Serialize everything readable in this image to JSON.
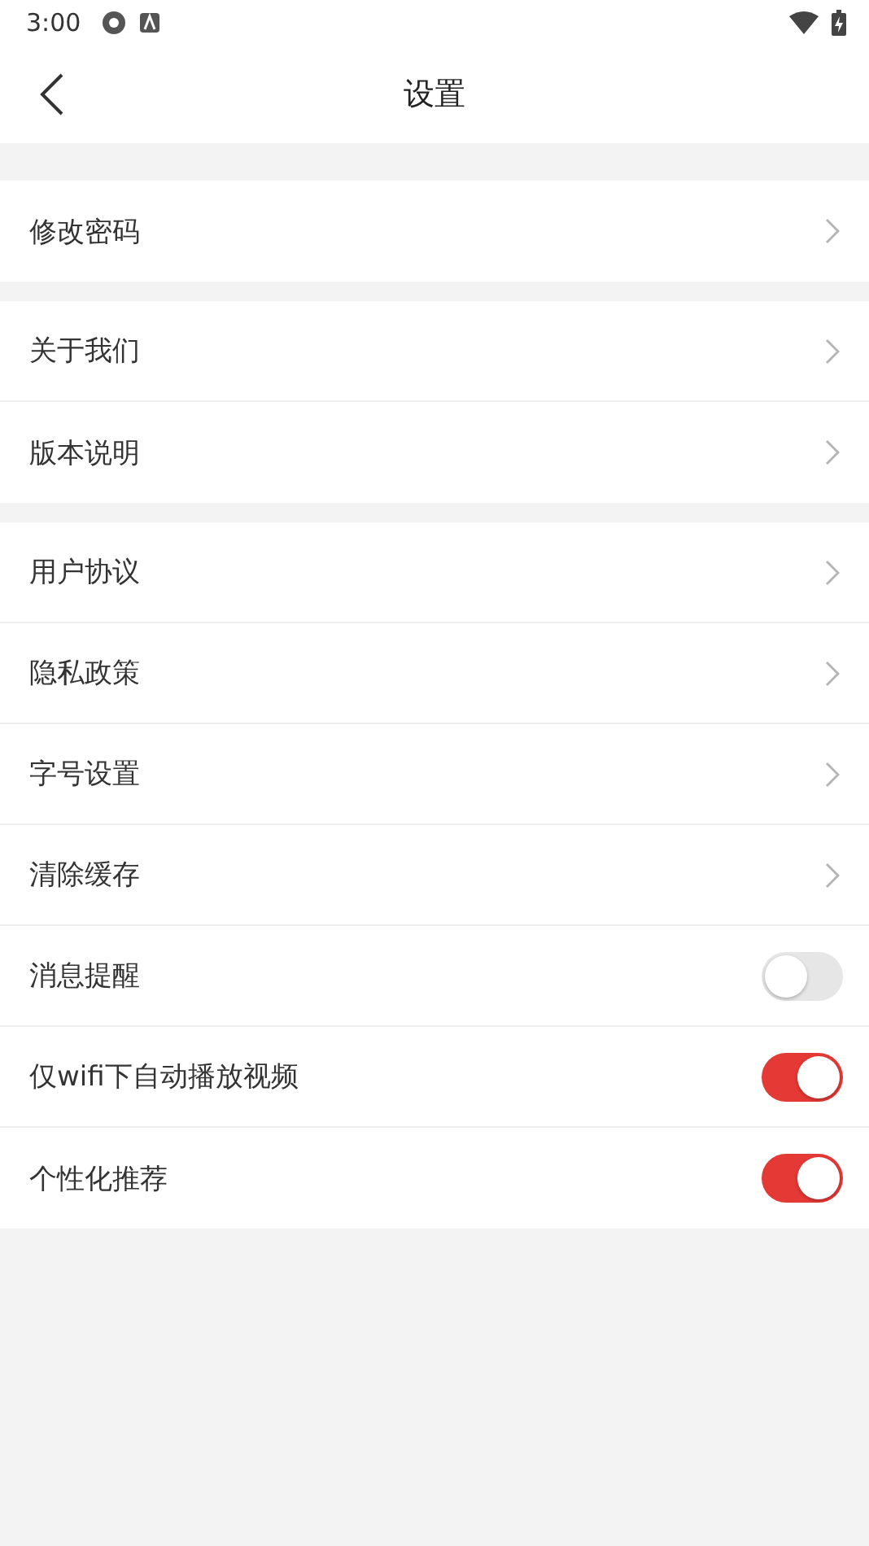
{
  "status_bar": {
    "time": "3:00"
  },
  "header": {
    "title": "设置"
  },
  "sections": [
    {
      "items": [
        {
          "kind": "link",
          "label": "修改密码"
        }
      ]
    },
    {
      "items": [
        {
          "kind": "link",
          "label": "关于我们"
        },
        {
          "kind": "link",
          "label": "版本说明"
        }
      ]
    },
    {
      "items": [
        {
          "kind": "link",
          "label": "用户协议"
        },
        {
          "kind": "link",
          "label": "隐私政策"
        },
        {
          "kind": "link",
          "label": "字号设置"
        },
        {
          "kind": "link",
          "label": "清除缓存"
        },
        {
          "kind": "toggle",
          "label": "消息提醒",
          "on": false
        },
        {
          "kind": "toggle",
          "label": "仅wifi下自动播放视频",
          "on": true
        },
        {
          "kind": "toggle",
          "label": "个性化推荐",
          "on": true
        }
      ]
    }
  ]
}
